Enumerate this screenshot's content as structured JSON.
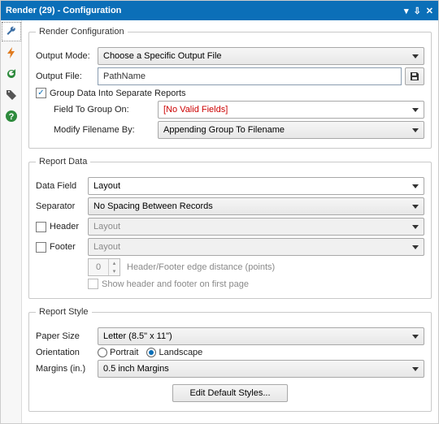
{
  "title": "Render (29) - Configuration",
  "groups": {
    "renderConfig": {
      "legend": "Render Configuration",
      "outputModeLabel": "Output Mode:",
      "outputMode": "Choose a Specific Output File",
      "outputFileLabel": "Output File:",
      "outputFile": "PathName",
      "groupDataCheckLabel": "Group Data Into Separate Reports",
      "groupDataChecked": "✓",
      "fieldToGroupLabel": "Field To Group On:",
      "fieldToGroupValue": "[No Valid Fields]",
      "modifyFilenameLabel": "Modify Filename By:",
      "modifyFilenameValue": "Appending Group To Filename"
    },
    "reportData": {
      "legend": "Report Data",
      "dataFieldLabel": "Data Field",
      "dataFieldValue": "Layout",
      "separatorLabel": "Separator",
      "separatorValue": "No Spacing Between Records",
      "headerLabel": "Header",
      "headerValue": "Layout",
      "footerLabel": "Footer",
      "footerValue": "Layout",
      "edgeDistValue": "0",
      "edgeDistLabel": "Header/Footer edge distance (points)",
      "showHFLabel": "Show header and footer on first page"
    },
    "reportStyle": {
      "legend": "Report Style",
      "paperSizeLabel": "Paper Size",
      "paperSizeValue": "Letter (8.5\" x 11\")",
      "orientationLabel": "Orientation",
      "portraitLabel": "Portrait",
      "landscapeLabel": "Landscape",
      "marginsLabel": "Margins (in.)",
      "marginsValue": "0.5 inch Margins",
      "editStylesLabel": "Edit Default Styles..."
    }
  }
}
